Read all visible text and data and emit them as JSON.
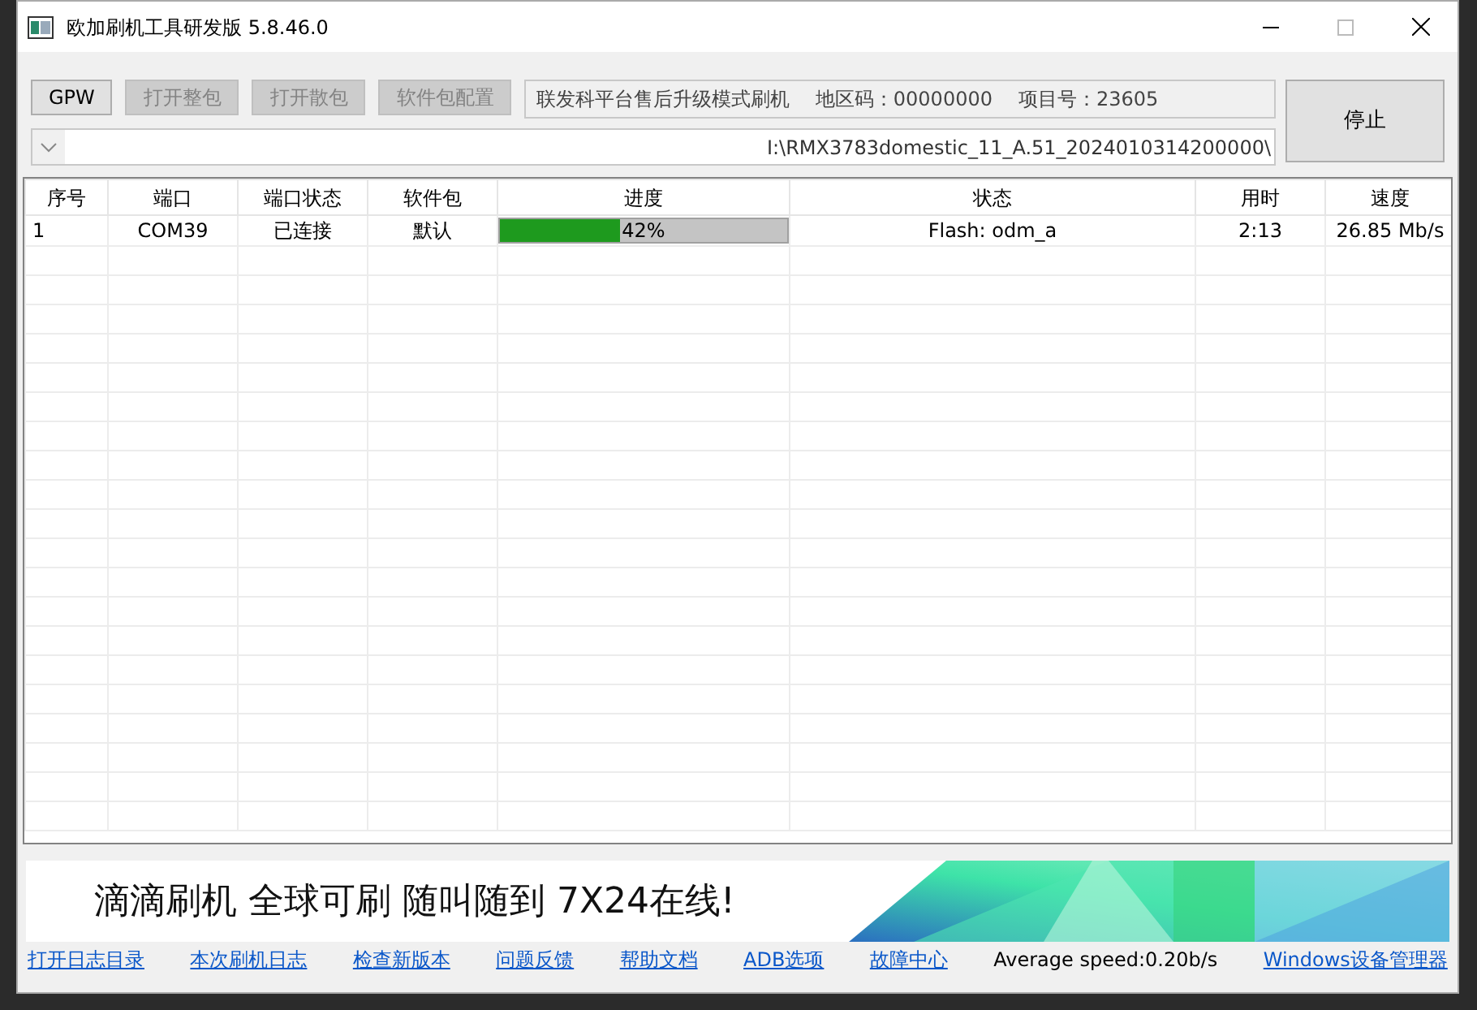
{
  "window": {
    "title": "欧加刷机工具研发版 5.8.46.0"
  },
  "toolbar": {
    "buttons": [
      {
        "label": "GPW",
        "disabled": false
      },
      {
        "label": "打开整包",
        "disabled": true
      },
      {
        "label": "打开散包",
        "disabled": true
      },
      {
        "label": "软件包配置",
        "disabled": true
      }
    ],
    "info": [
      "联发科平台售后升级模式刷机",
      "地区码：00000000",
      "项目号：23605"
    ],
    "path": "I:\\RMX3783domestic_11_A.51_2024010314200000\\",
    "stop_button": "停止"
  },
  "table": {
    "columns": [
      "序号",
      "端口",
      "端口状态",
      "软件包",
      "进度",
      "状态",
      "用时",
      "速度"
    ],
    "rows": [
      {
        "index": "1",
        "port": "COM39",
        "port_status": "已连接",
        "package": "默认",
        "level": 0.42,
        "progress": "42%",
        "status": "Flash: odm_a",
        "time": "2:13",
        "speed": "26.85 Mb/s"
      }
    ]
  },
  "banner": {
    "text": "滴滴刷机 全球可刷 随叫随到 7X24在线!"
  },
  "footer": {
    "links": [
      "打开日志目录",
      "本次刷机日志",
      "检查新版本",
      "问题反馈",
      "帮助文档",
      "ADB选项",
      "故障中心"
    ],
    "average_speed": "Average speed:0.20b/s",
    "device_manager": "Windows设备管理器"
  }
}
